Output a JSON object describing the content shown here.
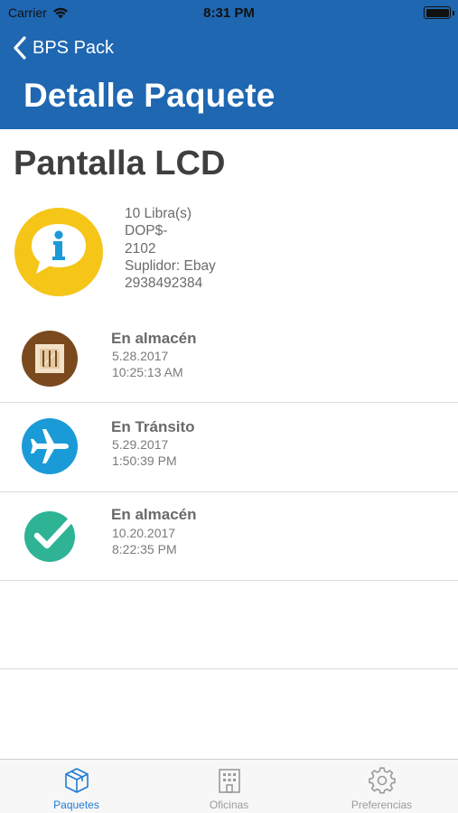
{
  "status_bar": {
    "carrier": "Carrier",
    "time": "8:31 PM",
    "wifi_icon": "wifi-icon",
    "battery_icon": "battery-icon"
  },
  "nav": {
    "back_label": "BPS Pack",
    "title": "Detalle Paquete",
    "bar_color": "#1f67b1"
  },
  "package": {
    "name": "Pantalla LCD",
    "info_icon": "info-speech-bubble-icon",
    "details": [
      "10 Libra(s)",
      "DOP$-",
      "2102",
      "Suplidor: Ebay",
      "2938492384"
    ]
  },
  "events": [
    {
      "icon": "crate-icon",
      "status": "En almacén",
      "date": "5.28.2017",
      "time": "10:25:13 AM"
    },
    {
      "icon": "airplane-icon",
      "status": "En Tránsito",
      "date": "5.29.2017",
      "time": "1:50:39 PM"
    },
    {
      "icon": "checkmark-icon",
      "status": "En almacén",
      "date": "10.20.2017",
      "time": "8:22:35 PM"
    }
  ],
  "tabs": [
    {
      "label": "Paquetes",
      "icon": "box-icon",
      "active": true
    },
    {
      "label": "Oficinas",
      "icon": "building-icon",
      "active": false
    },
    {
      "label": "Preferencias",
      "icon": "gear-icon",
      "active": false
    }
  ],
  "colors": {
    "accent": "#1f7bd6",
    "info_yellow": "#f5c518",
    "crate_brown": "#7a4a1e",
    "plane_blue": "#1a9bd7",
    "check_teal": "#2eb395"
  }
}
